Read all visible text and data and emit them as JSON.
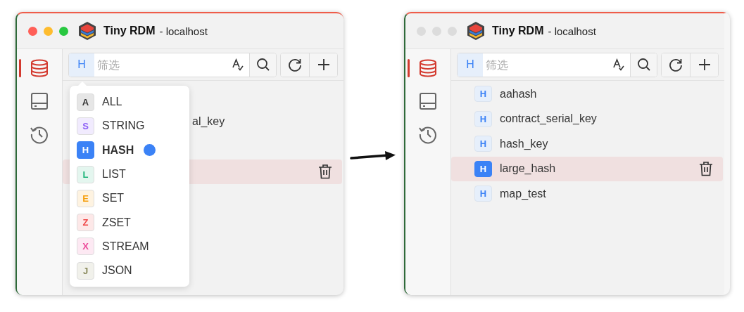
{
  "windows": [
    {
      "title": "Tiny RDM",
      "subtitle": "- localhost",
      "active": true,
      "sidebar": [
        {
          "kind": "database",
          "selected": true
        },
        {
          "kind": "server",
          "selected": false
        },
        {
          "kind": "history",
          "selected": false
        }
      ],
      "filter": {
        "type_badge": "H",
        "placeholder": "筛选"
      },
      "keys": [
        {
          "kind": "hidden",
          "selected": false
        },
        {
          "kind": "partial",
          "name": "al_key",
          "selected": false
        },
        {
          "kind": "hidden",
          "selected": false
        },
        {
          "kind": "hidden",
          "selected": true
        },
        {
          "kind": "hidden",
          "selected": false
        }
      ],
      "type_menu": [
        {
          "badge": "A",
          "label": "ALL",
          "color": "#333333",
          "selected": false
        },
        {
          "badge": "S",
          "label": "STRING",
          "color": "#8b5cf6",
          "selected": false
        },
        {
          "badge": "H",
          "label": "HASH",
          "color": "#3b82f6",
          "selected": true
        },
        {
          "badge": "L",
          "label": "LIST",
          "color": "#1fb57a",
          "selected": false
        },
        {
          "badge": "E",
          "label": "SET",
          "color": "#f59e0b",
          "selected": false
        },
        {
          "badge": "Z",
          "label": "ZSET",
          "color": "#ef4444",
          "selected": false
        },
        {
          "badge": "X",
          "label": "STREAM",
          "color": "#ec4899",
          "selected": false
        },
        {
          "badge": "J",
          "label": "JSON",
          "color": "#8a8a5c",
          "selected": false
        }
      ]
    },
    {
      "title": "Tiny RDM",
      "subtitle": "- localhost",
      "active": false,
      "sidebar": [
        {
          "kind": "database",
          "selected": true
        },
        {
          "kind": "server",
          "selected": false
        },
        {
          "kind": "history",
          "selected": false
        }
      ],
      "filter": {
        "type_badge": "H",
        "placeholder": "筛选"
      },
      "keys": [
        {
          "kind": "key",
          "badge": "H",
          "name": "aahash",
          "selected": false
        },
        {
          "kind": "key",
          "badge": "H",
          "name": "contract_serial_key",
          "selected": false
        },
        {
          "kind": "key",
          "badge": "H",
          "name": "hash_key",
          "selected": false
        },
        {
          "kind": "key",
          "badge": "H",
          "name": "large_hash",
          "selected": true
        },
        {
          "kind": "key",
          "badge": "H",
          "name": "map_test",
          "selected": false
        }
      ]
    }
  ]
}
